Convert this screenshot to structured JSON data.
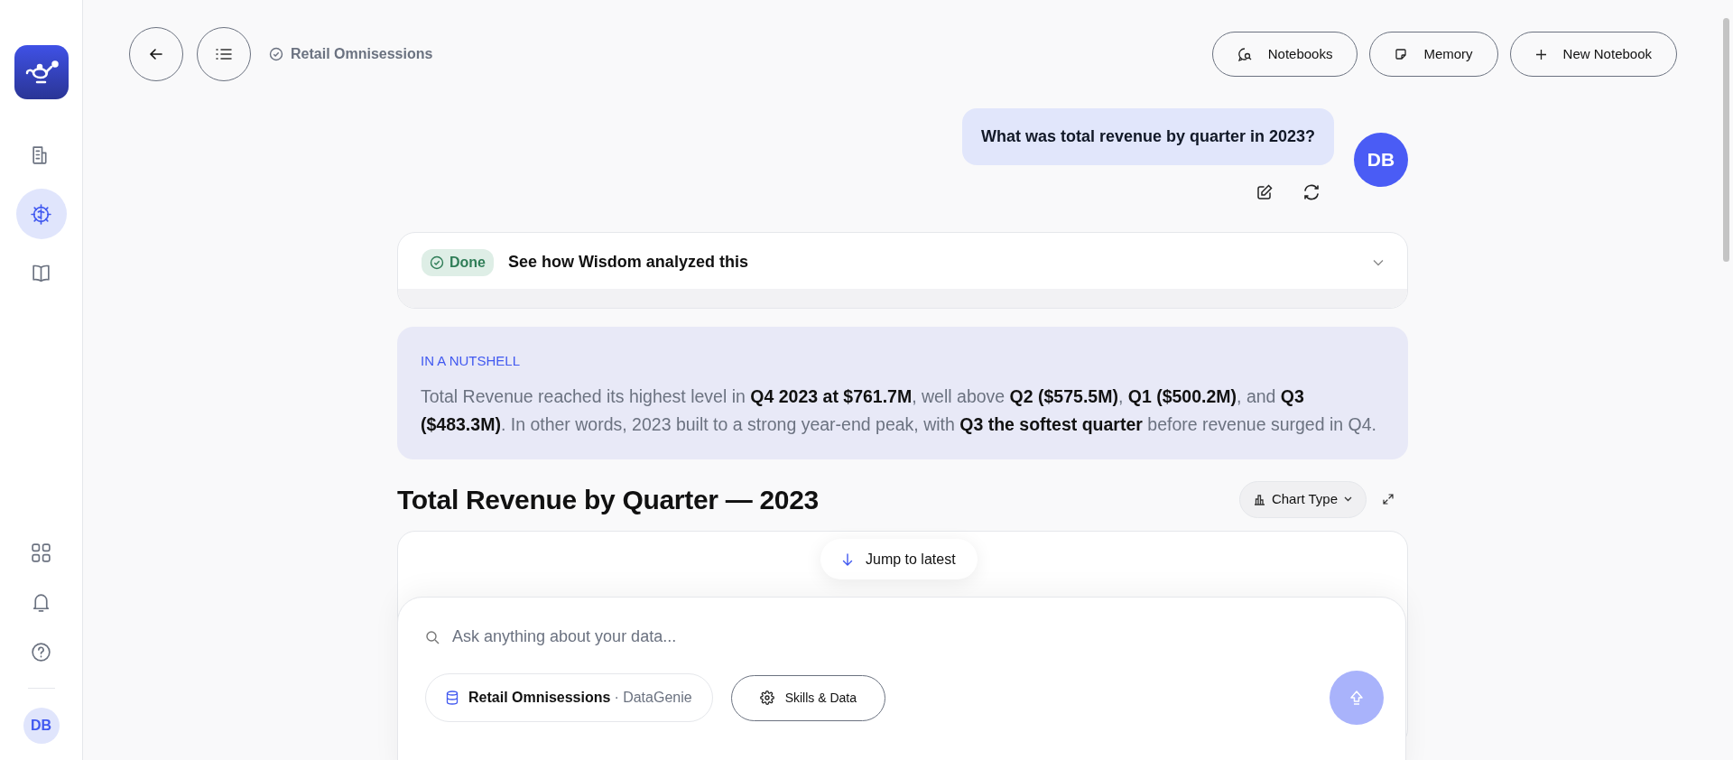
{
  "sidebar": {
    "top_items": [
      {
        "kind": "document",
        "selected": false
      },
      {
        "kind": "brain",
        "selected": true
      },
      {
        "kind": "book",
        "selected": false
      }
    ],
    "bottom_items": [
      {
        "kind": "grid"
      },
      {
        "kind": "bell"
      },
      {
        "kind": "help"
      }
    ],
    "user_initials": "DB"
  },
  "header": {
    "title": "Retail Omnisessions",
    "buttons": [
      {
        "kind": "notebooks",
        "label": "Notebooks"
      },
      {
        "kind": "memory",
        "label": "Memory"
      },
      {
        "kind": "new",
        "label": "New Notebook"
      }
    ]
  },
  "question": {
    "text": "What was total revenue by quarter in 2023?",
    "avatar": "DB"
  },
  "analysis": {
    "status": "Done",
    "title": "See how Wisdom analyzed this"
  },
  "nutshell": {
    "heading": "IN A NUTSHELL",
    "text": "Total Revenue reached its highest level in **Q4 2023 at $761.7M**, well above **Q2 ($575.5M)**, **Q1 ($500.2M)**, and **Q3 ($483.3M)**. In other words, 2023 built to a strong year-end peak, with **Q3 the softest quarter** before revenue surged in Q4."
  },
  "chart_section": {
    "title": "Total Revenue by Quarter — 2023",
    "chart_type_button": "Chart Type"
  },
  "jump_button": "Jump to latest",
  "composer": {
    "placeholder": "Ask anything about your data...",
    "source_name": "Retail Omnisessions",
    "source_provider": "· DataGenie",
    "skills_button": "Skills & Data"
  }
}
